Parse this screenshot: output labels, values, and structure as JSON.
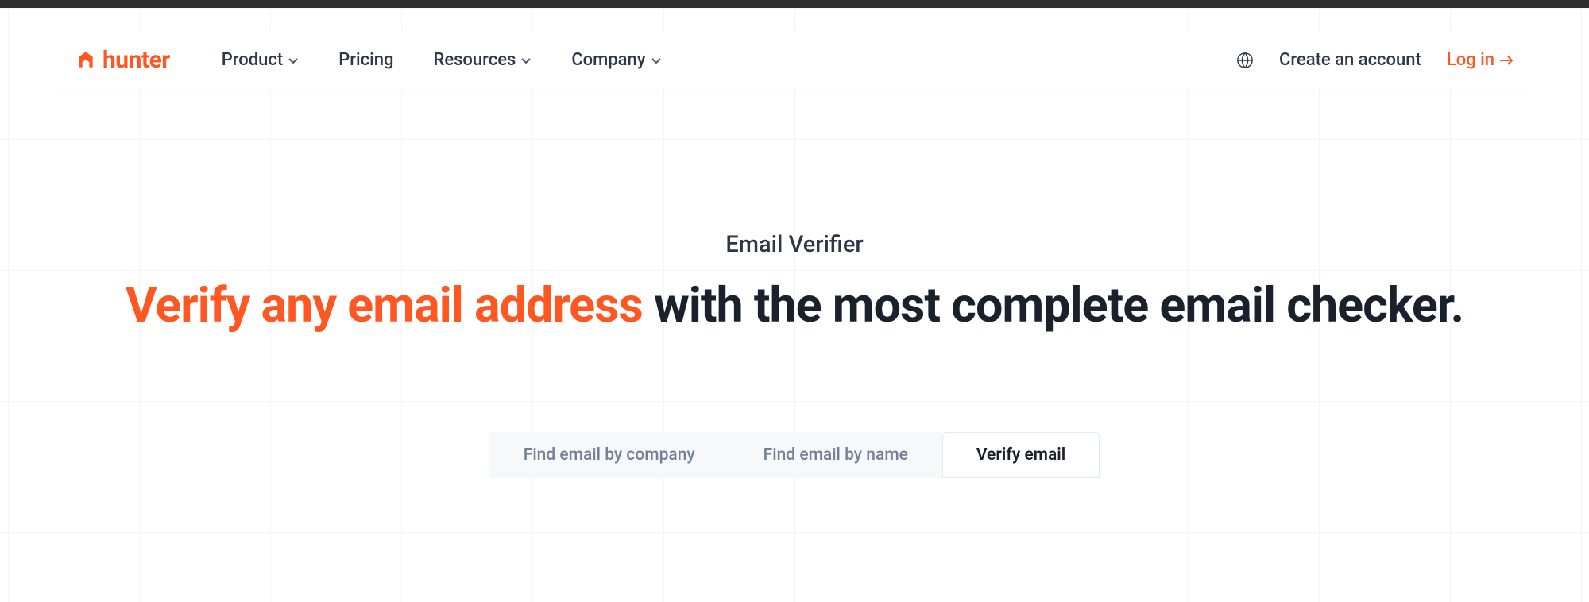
{
  "brand": {
    "name": "hunter"
  },
  "nav": {
    "product": "Product",
    "pricing": "Pricing",
    "resources": "Resources",
    "company": "Company"
  },
  "header_actions": {
    "create_account": "Create an account",
    "login": "Log in"
  },
  "hero": {
    "subtitle": "Email Verifier",
    "headline_accent": "Verify any email address",
    "headline_rest": " with the most complete email checker."
  },
  "tabs": {
    "find_by_company": "Find email by company",
    "find_by_name": "Find email by name",
    "verify_email": "Verify email"
  },
  "colors": {
    "accent": "#ff5722",
    "text_dark": "#1a202c",
    "text_muted": "#718096"
  }
}
